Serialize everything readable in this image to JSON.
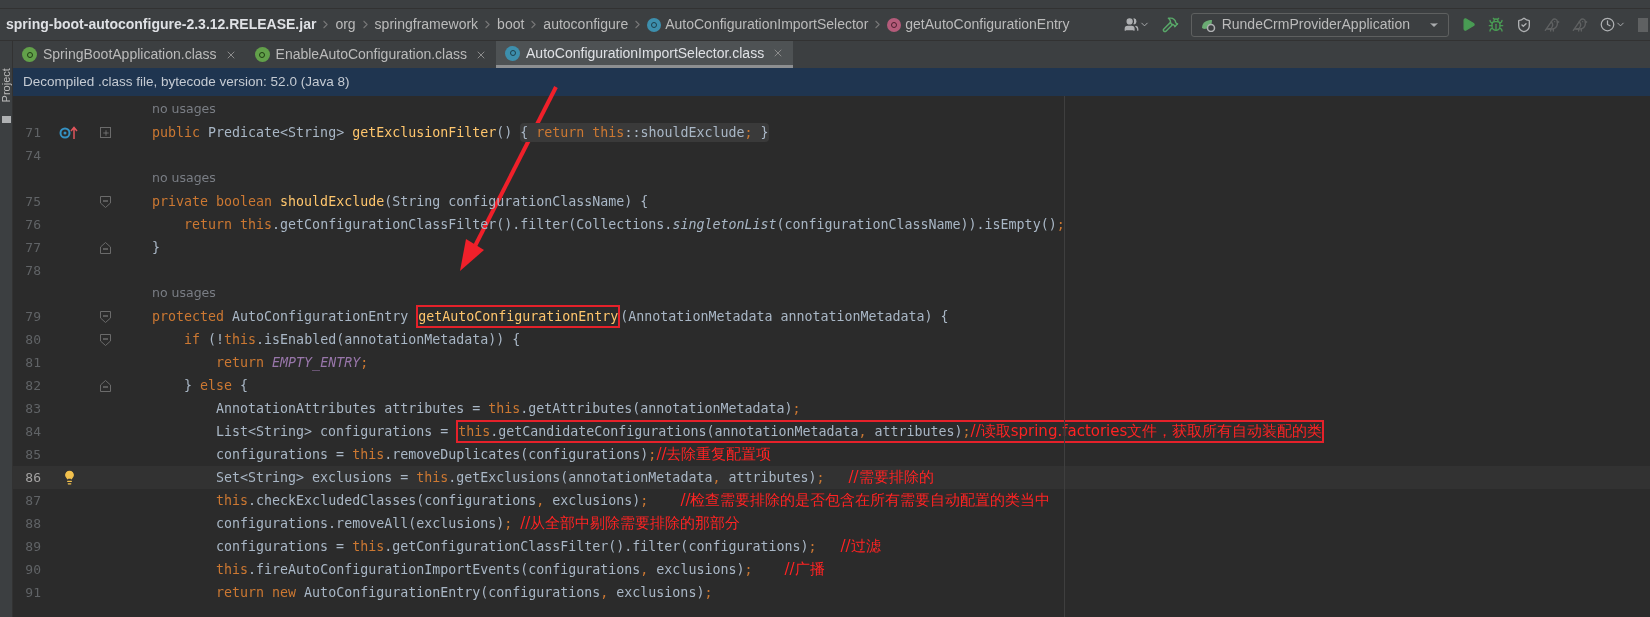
{
  "breadcrumb": [
    {
      "kind": "jar",
      "text": "spring-boot-autoconfigure-2.3.12.RELEASE.jar"
    },
    {
      "kind": "package",
      "text": "org"
    },
    {
      "kind": "package",
      "text": "springframework"
    },
    {
      "kind": "package",
      "text": "boot"
    },
    {
      "kind": "package",
      "text": "autoconfigure"
    },
    {
      "kind": "class",
      "text": "AutoConfigurationImportSelector"
    },
    {
      "kind": "method",
      "text": "getAutoConfigurationEntry"
    }
  ],
  "run_config": {
    "label": "RundeCrmProviderApplication"
  },
  "tabs": [
    {
      "label": "SpringBootApplication.class",
      "kind": "annotation",
      "selected": false
    },
    {
      "label": "EnableAutoConfiguration.class",
      "kind": "annotation",
      "selected": false
    },
    {
      "label": "AutoConfigurationImportSelector.class",
      "kind": "class",
      "selected": true
    }
  ],
  "side_panel": {
    "label": "Project"
  },
  "banner": {
    "text": "Decompiled .class file, bytecode version: 52.0 (Java 8)"
  },
  "lines": [
    {
      "kind": "hint",
      "text": "no usages"
    },
    {
      "kind": "code",
      "number": "71",
      "current": false,
      "gutter_icons": [
        {
          "kind": "override"
        },
        {
          "kind": "expand"
        }
      ],
      "tokens": [
        {
          "kind": "keyword",
          "text": "public "
        },
        {
          "kind": "plain",
          "text": "Predicate<String> "
        },
        {
          "kind": "method",
          "text": "getExclusionFilter"
        },
        {
          "kind": "plain",
          "text": "() "
        },
        {
          "kind": "folded",
          "tokens": [
            {
              "kind": "plain",
              "text": "{ "
            },
            {
              "kind": "keyword",
              "text": "return this"
            },
            {
              "kind": "plain",
              "text": "::shouldExclude"
            },
            {
              "kind": "keyword",
              "text": ";"
            },
            {
              "kind": "plain",
              "text": " }"
            }
          ]
        }
      ]
    },
    {
      "kind": "code",
      "number": "74",
      "current": false
    },
    {
      "kind": "hint",
      "text": "no usages"
    },
    {
      "kind": "code",
      "number": "75",
      "current": false,
      "gutter_icons": [
        {
          "kind": "fold-start"
        }
      ],
      "tokens": [
        {
          "kind": "keyword",
          "text": "private boolean "
        },
        {
          "kind": "method",
          "text": "shouldExclude"
        },
        {
          "kind": "plain",
          "text": "(String configurationClassName) {"
        }
      ]
    },
    {
      "kind": "code",
      "number": "76",
      "current": false,
      "tokens": [
        {
          "kind": "keyword",
          "text": "    return this"
        },
        {
          "kind": "plain",
          "text": ".getConfigurationClassFilter().filter(Collections."
        },
        {
          "kind": "italic",
          "text": "singletonList"
        },
        {
          "kind": "plain",
          "text": "(configurationClassName)).isEmpty()"
        },
        {
          "kind": "keyword",
          "text": ";"
        }
      ]
    },
    {
      "kind": "code",
      "number": "77",
      "current": false,
      "gutter_icons": [
        {
          "kind": "fold-end"
        }
      ],
      "tokens": [
        {
          "kind": "plain",
          "text": "}"
        }
      ]
    },
    {
      "kind": "code",
      "number": "78",
      "current": false
    },
    {
      "kind": "hint",
      "text": "no usages"
    },
    {
      "kind": "code",
      "number": "79",
      "current": false,
      "gutter_icons": [
        {
          "kind": "fold-start"
        }
      ],
      "tokens": [
        {
          "kind": "keyword",
          "text": "protected "
        },
        {
          "kind": "plain",
          "text": "AutoConfigurationEntry "
        },
        {
          "kind": "box",
          "tokens": [
            {
              "kind": "method",
              "text": "getAutoConfigurationEntry"
            }
          ]
        },
        {
          "kind": "plain",
          "text": "(AnnotationMetadata annotationMetadata) {"
        }
      ]
    },
    {
      "kind": "code",
      "number": "80",
      "current": false,
      "gutter_icons": [
        {
          "kind": "fold-start"
        }
      ],
      "tokens": [
        {
          "kind": "keyword",
          "text": "    if "
        },
        {
          "kind": "plain",
          "text": "(!"
        },
        {
          "kind": "keyword",
          "text": "this"
        },
        {
          "kind": "plain",
          "text": ".isEnabled(annotationMetadata)) {"
        }
      ]
    },
    {
      "kind": "code",
      "number": "81",
      "current": false,
      "tokens": [
        {
          "kind": "keyword",
          "text": "        return "
        },
        {
          "kind": "constant",
          "text": "EMPTY_ENTRY"
        },
        {
          "kind": "keyword",
          "text": ";"
        }
      ]
    },
    {
      "kind": "code",
      "number": "82",
      "current": false,
      "gutter_icons": [
        {
          "kind": "fold-end"
        }
      ],
      "tokens": [
        {
          "kind": "plain",
          "text": "    } "
        },
        {
          "kind": "keyword",
          "text": "else "
        },
        {
          "kind": "plain",
          "text": "{"
        }
      ]
    },
    {
      "kind": "code",
      "number": "83",
      "current": false,
      "tokens": [
        {
          "kind": "plain",
          "text": "        AnnotationAttributes attributes = "
        },
        {
          "kind": "keyword",
          "text": "this"
        },
        {
          "kind": "plain",
          "text": ".getAttributes(annotationMetadata)"
        },
        {
          "kind": "keyword",
          "text": ";"
        }
      ]
    },
    {
      "kind": "code",
      "number": "84",
      "current": false,
      "tokens": [
        {
          "kind": "plain",
          "text": "        List<String> configurations = "
        },
        {
          "kind": "box",
          "tokens": [
            {
              "kind": "keyword",
              "text": "this"
            },
            {
              "kind": "plain",
              "text": ".getCandidateConfigurations(annotationMetadata"
            },
            {
              "kind": "keyword",
              "text": ", "
            },
            {
              "kind": "plain",
              "text": "attributes)"
            },
            {
              "kind": "keyword",
              "text": ";"
            },
            {
              "kind": "note",
              "text": "//读取spring.factories文件，获取所有自动装配的类"
            }
          ]
        }
      ]
    },
    {
      "kind": "code",
      "number": "85",
      "current": false,
      "tokens": [
        {
          "kind": "plain",
          "text": "        configurations = "
        },
        {
          "kind": "keyword",
          "text": "this"
        },
        {
          "kind": "plain",
          "text": ".removeDuplicates(configurations)"
        },
        {
          "kind": "keyword",
          "text": ";"
        },
        {
          "kind": "note",
          "text": "//去除重复配置项"
        }
      ]
    },
    {
      "kind": "code",
      "number": "86",
      "current": true,
      "gutter_icons": [
        {
          "kind": "bulb"
        }
      ],
      "tokens": [
        {
          "kind": "plain",
          "text": "        Set<String> exclusions = "
        },
        {
          "kind": "keyword",
          "text": "this"
        },
        {
          "kind": "plain",
          "text": ".getExclusions(annotationMetadata"
        },
        {
          "kind": "keyword",
          "text": ", "
        },
        {
          "kind": "plain",
          "text": "attributes)"
        },
        {
          "kind": "keyword",
          "text": ";   "
        },
        {
          "kind": "note",
          "text": "//需要排除的"
        }
      ]
    },
    {
      "kind": "code",
      "number": "87",
      "current": false,
      "tokens": [
        {
          "kind": "keyword",
          "text": "        this"
        },
        {
          "kind": "plain",
          "text": ".checkExcludedClasses(configurations"
        },
        {
          "kind": "keyword",
          "text": ", "
        },
        {
          "kind": "plain",
          "text": "exclusions)"
        },
        {
          "kind": "keyword",
          "text": ";    "
        },
        {
          "kind": "note",
          "text": "//检查需要排除的是否包含在所有需要自动配置的类当中"
        }
      ]
    },
    {
      "kind": "code",
      "number": "88",
      "current": false,
      "tokens": [
        {
          "kind": "plain",
          "text": "        configurations.removeAll(exclusions)"
        },
        {
          "kind": "keyword",
          "text": "; "
        },
        {
          "kind": "note",
          "text": "//从全部中剔除需要排除的那部分"
        }
      ]
    },
    {
      "kind": "code",
      "number": "89",
      "current": false,
      "tokens": [
        {
          "kind": "plain",
          "text": "        configurations = "
        },
        {
          "kind": "keyword",
          "text": "this"
        },
        {
          "kind": "plain",
          "text": ".getConfigurationClassFilter().filter(configurations)"
        },
        {
          "kind": "keyword",
          "text": ";   "
        },
        {
          "kind": "note",
          "text": "//过滤"
        }
      ]
    },
    {
      "kind": "code",
      "number": "90",
      "current": false,
      "tokens": [
        {
          "kind": "keyword",
          "text": "        this"
        },
        {
          "kind": "plain",
          "text": ".fireAutoConfigurationImportEvents(configurations"
        },
        {
          "kind": "keyword",
          "text": ", "
        },
        {
          "kind": "plain",
          "text": "exclusions)"
        },
        {
          "kind": "keyword",
          "text": ";    "
        },
        {
          "kind": "note",
          "text": "//广播"
        }
      ]
    },
    {
      "kind": "code",
      "number": "91",
      "current": false,
      "tokens": [
        {
          "kind": "keyword",
          "text": "        return new "
        },
        {
          "kind": "plain",
          "text": "AutoConfigurationEntry(configurations"
        },
        {
          "kind": "keyword",
          "text": ", "
        },
        {
          "kind": "plain",
          "text": "exclusions)"
        },
        {
          "kind": "keyword",
          "text": ";"
        }
      ]
    }
  ]
}
